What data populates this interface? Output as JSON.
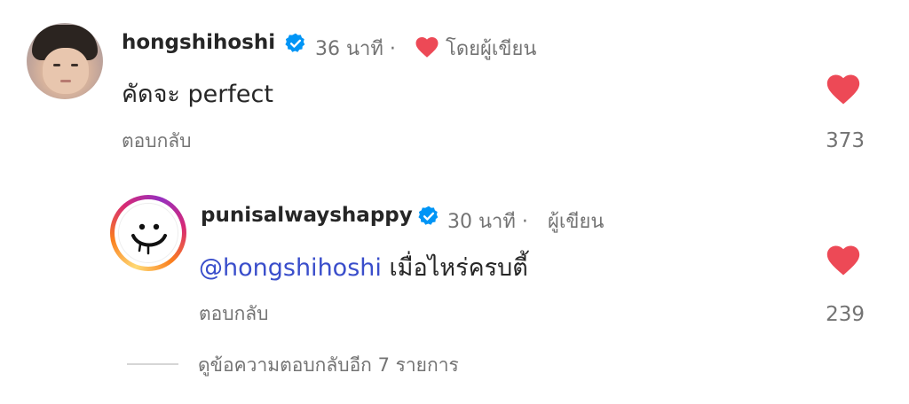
{
  "comments": [
    {
      "username": "hongshihoshi",
      "time": "36 นาที ·",
      "liked_by_author_label": "โดยผู้เขียน",
      "text": "คัดจะ perfect",
      "reply_label": "ตอบกลับ",
      "like_count": "373",
      "avatar": "profile-photo"
    },
    {
      "username": "punisalwayshappy",
      "time": "30 นาที ·",
      "author_label": "ผู้เขียน",
      "mention": "@hongshihoshi",
      "text": " เมื่อไหร่ครบตี้",
      "reply_label": "ตอบกลับ",
      "like_count": "239",
      "avatar": "smiley-face-logo"
    }
  ],
  "view_more_replies": "ดูข้อความตอบกลับอีก 7 รายการ",
  "colors": {
    "heart": "#ed4956",
    "verified": "#0095f6",
    "mention": "#3a4ecb",
    "secondary_text": "#737373"
  }
}
